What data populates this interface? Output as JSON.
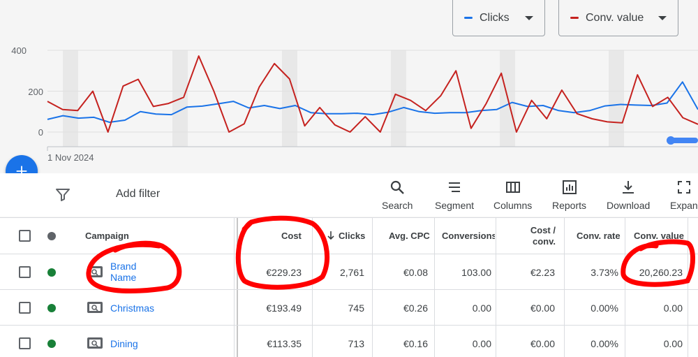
{
  "metrics": {
    "clicks": {
      "label": "Clicks",
      "color": "#1a73e8"
    },
    "conv_value": {
      "label": "Conv. value",
      "color": "#c5221f"
    }
  },
  "chart_data": {
    "type": "line",
    "y_ticks": [
      "400",
      "200",
      "0"
    ],
    "ylim": [
      0,
      400
    ],
    "x_start_label": "1 Nov 2024",
    "series": [
      {
        "name": "Clicks",
        "color": "#1a73e8",
        "values": [
          62,
          80,
          68,
          72,
          48,
          58,
          100,
          88,
          85,
          122,
          127,
          138,
          150,
          118,
          130,
          115,
          130,
          95,
          90,
          90,
          92,
          85,
          97,
          120,
          100,
          92,
          95,
          95,
          105,
          110,
          145,
          125,
          130,
          105,
          95,
          105,
          128,
          135,
          132,
          130,
          142,
          245,
          110
        ]
      },
      {
        "name": "Conv. value",
        "color": "#c5221f",
        "values": [
          150,
          110,
          105,
          200,
          0,
          225,
          258,
          125,
          140,
          170,
          372,
          200,
          0,
          40,
          220,
          335,
          260,
          30,
          120,
          35,
          0,
          75,
          0,
          185,
          155,
          105,
          178,
          300,
          18,
          140,
          288,
          0,
          155,
          65,
          205,
          90,
          65,
          50,
          45,
          280,
          125,
          170,
          70,
          38
        ]
      }
    ]
  },
  "toolbar": {
    "add_filter": "Add filter",
    "buttons": [
      "Search",
      "Segment",
      "Columns",
      "Reports",
      "Download",
      "Expan"
    ]
  },
  "table": {
    "headers": {
      "campaign": "Campaign",
      "cost": "Cost",
      "clicks": "Clicks",
      "avg_cpc": "Avg. CPC",
      "conversions": "Conversions",
      "cost_conv_1": "Cost /",
      "cost_conv_2": "conv.",
      "conv_rate": "Conv. rate",
      "conv_value": "Conv. value"
    },
    "rows": [
      {
        "name_1": "Brand",
        "name_2": "Name",
        "cost": "€229.23",
        "clicks": "2,761",
        "avg_cpc": "€0.08",
        "conversions": "103.00",
        "cost_conv": "€2.23",
        "conv_rate": "3.73%",
        "conv_value": "20,260.23"
      },
      {
        "name_1": "Christmas",
        "name_2": "",
        "cost": "€193.49",
        "clicks": "745",
        "avg_cpc": "€0.26",
        "conversions": "0.00",
        "cost_conv": "€0.00",
        "conv_rate": "0.00%",
        "conv_value": "0.00"
      },
      {
        "name_1": "Dining",
        "name_2": "",
        "cost": "€113.35",
        "clicks": "713",
        "avg_cpc": "€0.16",
        "conversions": "0.00",
        "cost_conv": "€0.00",
        "conv_rate": "0.00%",
        "conv_value": "0.00"
      }
    ],
    "status_colors": {
      "enabled": "#188038",
      "header_dot": "#5f6368"
    }
  },
  "annotation_color": "#ff0000"
}
